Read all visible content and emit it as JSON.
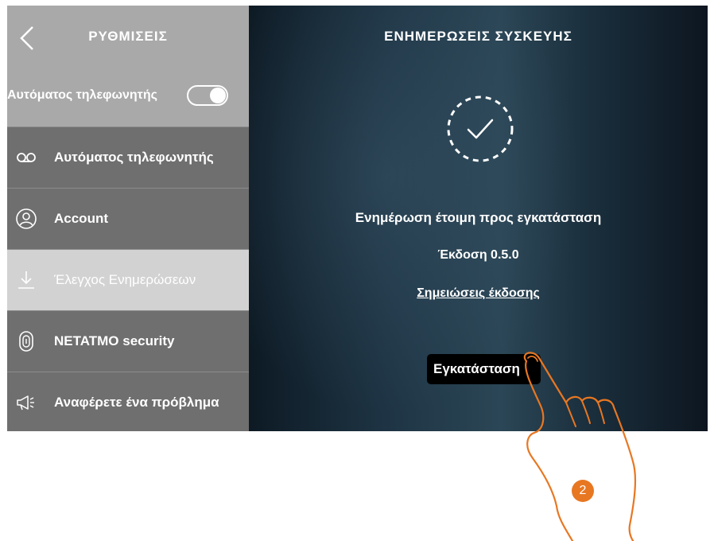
{
  "sidebar": {
    "title": "ΡΥΘΜΙΣΕΙΣ",
    "auto_answer_toggle": {
      "label": "Αυτόματος τηλεφωνητής",
      "on": true
    },
    "items": [
      {
        "label": "Αυτόματος τηλεφωνητής",
        "icon": "voicemail-icon",
        "active": false
      },
      {
        "label": "Account",
        "icon": "user-icon",
        "active": false
      },
      {
        "label": "Έλεγχος Ενημερώσεων",
        "icon": "download-icon",
        "active": true
      },
      {
        "label": "NETATMO security",
        "icon": "doorbell-icon",
        "active": false
      },
      {
        "label": "Αναφέρετε ένα πρόβλημα",
        "icon": "megaphone-icon",
        "active": false
      }
    ]
  },
  "main": {
    "title": "ΕΝΗΜΕΡΩΣΕΙΣ ΣΥΣΚΕΥΗΣ",
    "status_icon": "check-circle-icon",
    "status": "Ενημέρωση έτοιμη προς εγκατάσταση",
    "version": "Έκδοση 0.5.0",
    "release_notes_link": "Σημειώσεις έκδοσης",
    "install_button": "Εγκατάσταση"
  },
  "annotation": {
    "step_number": "2",
    "accent": "#e87722"
  },
  "colors": {
    "sidebar_header": "#a9a9a9",
    "sidebar_bg": "#6f6f6f",
    "active_item": "#d2d2d2",
    "button": "#000000"
  }
}
